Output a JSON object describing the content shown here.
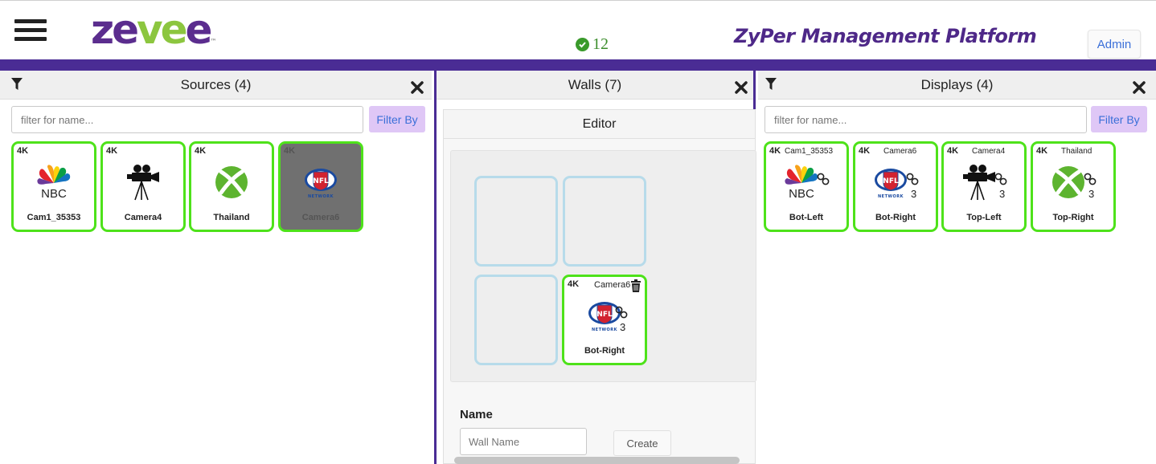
{
  "header": {
    "logo_text_z": "ze",
    "logo_text_v": "ve",
    "logo_text_e": "e",
    "logo_tm": "™",
    "status_count": "12",
    "platform_title": "ZyPer Management Platform",
    "admin_label": "Admin"
  },
  "colors": {
    "accent_purple": "#4a2c94",
    "tile_border_green": "#4ee21a",
    "filter_button_bg": "#dfc7f6",
    "empty_cell_border": "#b7dbea"
  },
  "sources": {
    "title": "Sources (4)",
    "filter_placeholder": "filter for name...",
    "filter_button": "Filter By",
    "tiles": [
      {
        "res": "4K",
        "name": "Cam1_35353",
        "icon": "nbc-icon"
      },
      {
        "res": "4K",
        "name": "Camera4",
        "icon": "video-camera-icon"
      },
      {
        "res": "4K",
        "name": "Thailand",
        "icon": "xbox-icon"
      },
      {
        "res": "4K",
        "name": "Camera6",
        "icon": "nfl-network-icon",
        "selected": true
      }
    ]
  },
  "walls": {
    "title": "Walls (7)",
    "editor_title": "Editor",
    "filled_cell": {
      "res": "4K",
      "device": "Camera6",
      "channel": "3",
      "name": "Bot-Right",
      "icon": "nfl-network-icon"
    },
    "name_label": "Name",
    "wall_name_placeholder": "Wall Name",
    "create_button": "Create"
  },
  "displays": {
    "title": "Displays (4)",
    "filter_placeholder": "filter for name...",
    "filter_button": "Filter By",
    "tiles": [
      {
        "res": "4K",
        "device": "Cam1_35353",
        "name": "Bot-Left",
        "channel": "",
        "icon": "nbc-icon"
      },
      {
        "res": "4K",
        "device": "Camera6",
        "name": "Bot-Right",
        "channel": "3",
        "icon": "nfl-network-icon"
      },
      {
        "res": "4K",
        "device": "Camera4",
        "name": "Top-Left",
        "channel": "3",
        "icon": "video-camera-icon"
      },
      {
        "res": "4K",
        "device": "Thailand",
        "name": "Top-Right",
        "channel": "3",
        "icon": "xbox-icon"
      }
    ]
  }
}
